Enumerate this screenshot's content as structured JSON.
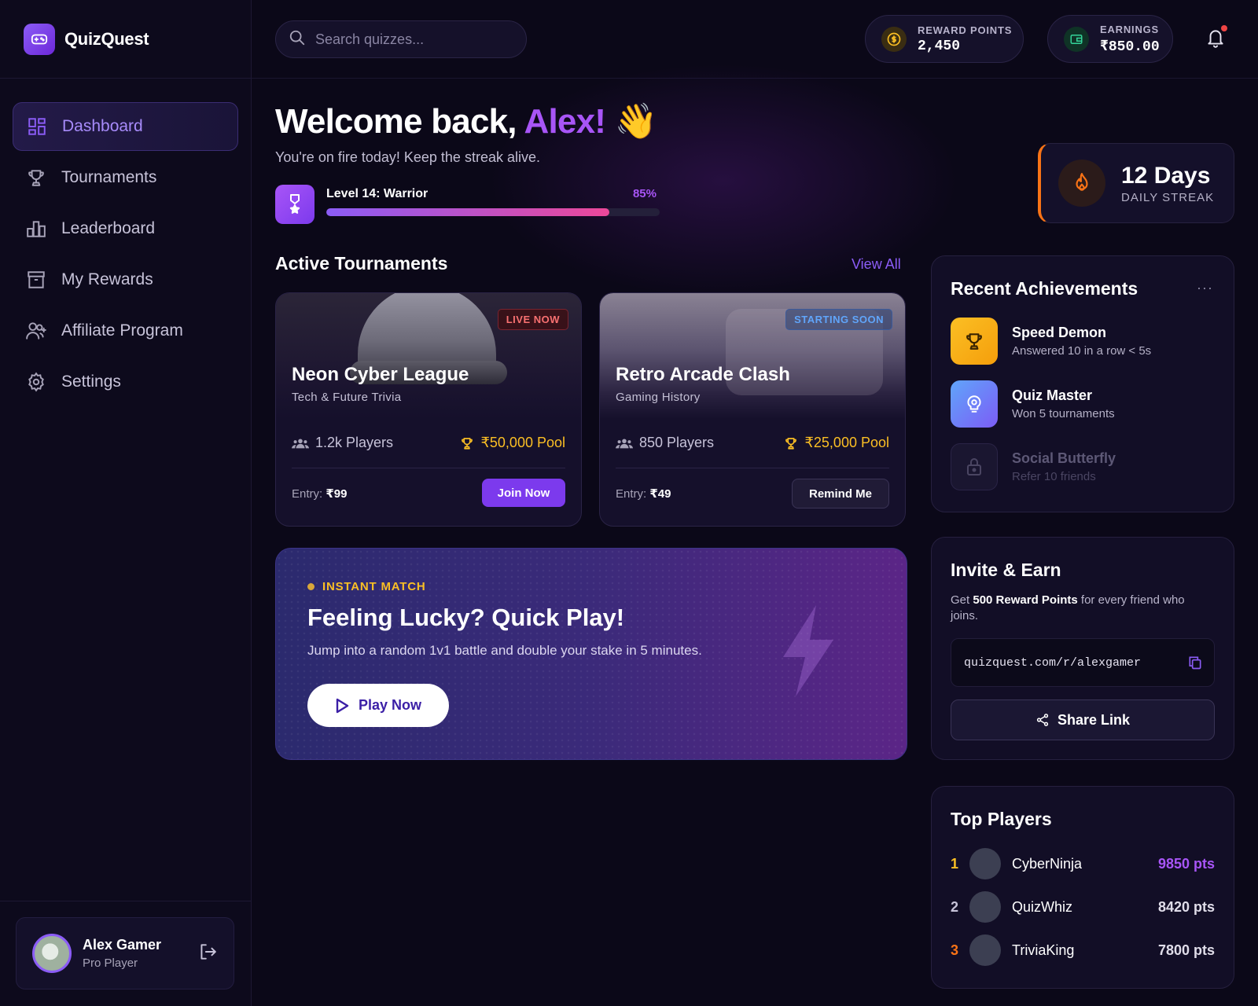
{
  "brand": {
    "name": "QuizQuest"
  },
  "nav": {
    "items": [
      {
        "label": "Dashboard",
        "icon": "dashboard-icon",
        "active": true
      },
      {
        "label": "Tournaments",
        "icon": "trophy-icon"
      },
      {
        "label": "Leaderboard",
        "icon": "leaderboard-icon"
      },
      {
        "label": "My Rewards",
        "icon": "archive-box-icon"
      },
      {
        "label": "Affiliate Program",
        "icon": "user-plus-icon"
      },
      {
        "label": "Settings",
        "icon": "gear-icon"
      }
    ]
  },
  "user": {
    "name": "Alex Gamer",
    "role": "Pro Player"
  },
  "header": {
    "search_placeholder": "Search quizzes...",
    "reward_points": {
      "label": "REWARD POINTS",
      "value": "2,450"
    },
    "earnings": {
      "label": "EARNINGS",
      "value": "₹850.00"
    },
    "notification_dot": true
  },
  "welcome": {
    "prefix": "Welcome back, ",
    "name": "Alex!",
    "emoji": "👋",
    "subtitle": "You're on fire today! Keep the streak alive."
  },
  "level": {
    "title": "Level 14: Warrior",
    "percent_label": "85%",
    "progress": 0.85
  },
  "streak": {
    "days": "12 Days",
    "label": "DAILY STREAK"
  },
  "tournaments": {
    "title": "Active Tournaments",
    "view_all": "View All",
    "items": [
      {
        "badge": "LIVE NOW",
        "name": "Neon Cyber League",
        "category": "Tech & Future Trivia",
        "players": "1.2k Players",
        "pool": "₹50,000 Pool",
        "entry_label": "Entry:",
        "entry_value": "₹99",
        "action": "Join Now"
      },
      {
        "badge": "STARTING SOON",
        "name": "Retro Arcade Clash",
        "category": "Gaming History",
        "players": "850 Players",
        "pool": "₹25,000 Pool",
        "entry_label": "Entry:",
        "entry_value": "₹49",
        "action": "Remind Me"
      }
    ]
  },
  "quick_play": {
    "tag": "INSTANT MATCH",
    "title": "Feeling Lucky? Quick Play!",
    "subtitle": "Jump into a random 1v1 battle and double your stake in 5 minutes.",
    "button": "Play Now"
  },
  "achievements": {
    "title": "Recent Achievements",
    "more": "···",
    "items": [
      {
        "name": "Speed Demon",
        "desc": "Answered 10 in a row < 5s",
        "icon": "trophy-icon",
        "color": "#f59e0b",
        "locked": false
      },
      {
        "name": "Quiz Master",
        "desc": "Won 5 tournaments",
        "icon": "brain-icon",
        "color": "#60a5fa",
        "locked": false
      },
      {
        "name": "Social Butterfly",
        "desc": "Refer 10 friends",
        "icon": "lock-icon",
        "color": "#5d5876",
        "locked": true
      }
    ]
  },
  "invite": {
    "title": "Invite & Earn",
    "text_prefix": "Get ",
    "text_bold": "500 Reward Points",
    "text_suffix": " for every friend who joins.",
    "link": "quizquest.com/r/alexgamer",
    "button": "Share Link"
  },
  "top_players": {
    "title": "Top Players",
    "items": [
      {
        "rank": "1",
        "name": "CyberNinja",
        "points": "9850 pts",
        "rank_color": "#fbbf24"
      },
      {
        "rank": "2",
        "name": "QuizWhiz",
        "points": "8420 pts",
        "rank_color": "#c7c3d9"
      },
      {
        "rank": "3",
        "name": "TriviaKing",
        "points": "7800 pts",
        "rank_color": "#f97316"
      }
    ]
  },
  "colors": {
    "accent": "#8b5cf6",
    "accent_pink": "#ec4899",
    "gold": "#fbbf24",
    "live_red": "#f87171",
    "soon_blue": "#60a5fa",
    "streak_orange": "#f97316"
  }
}
